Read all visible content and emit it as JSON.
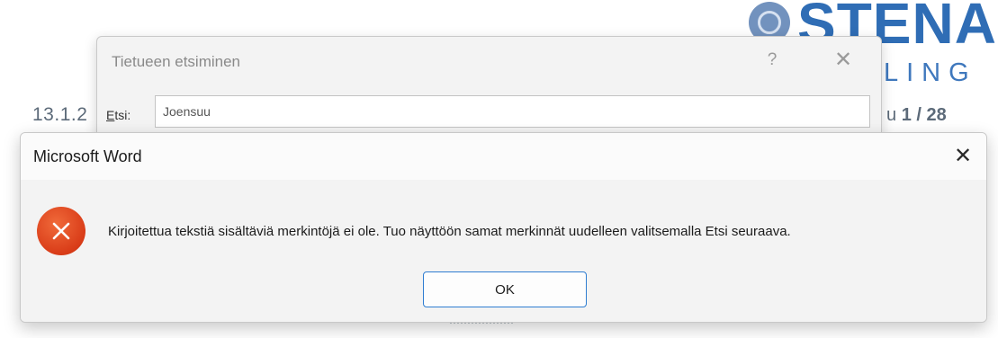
{
  "background": {
    "logo": {
      "text": "STENA",
      "subtext": "LING"
    },
    "date_fragment": "13.1.2",
    "page_indicator": {
      "prefix": "u ",
      "value": "1 / 28"
    }
  },
  "find_dialog": {
    "title": "Tietueen etsiminen",
    "help_glyph": "?",
    "close_glyph": "✕",
    "search_label_first": "E",
    "search_label_rest": "tsi:",
    "search_value": "Joensuu"
  },
  "message_box": {
    "title": "Microsoft Word",
    "close_glyph": "✕",
    "icon": "error-icon",
    "message": "Kirjoitettua tekstiä sisältäviä merkintöjä ei ole. Tuo näyttöön samat merkinnät uudelleen valitsemalla Etsi seuraava.",
    "ok_label": "OK"
  },
  "colors": {
    "accent": "#2f7dd1",
    "error": "#d93c18",
    "logo_blue": "#2f6db5"
  }
}
